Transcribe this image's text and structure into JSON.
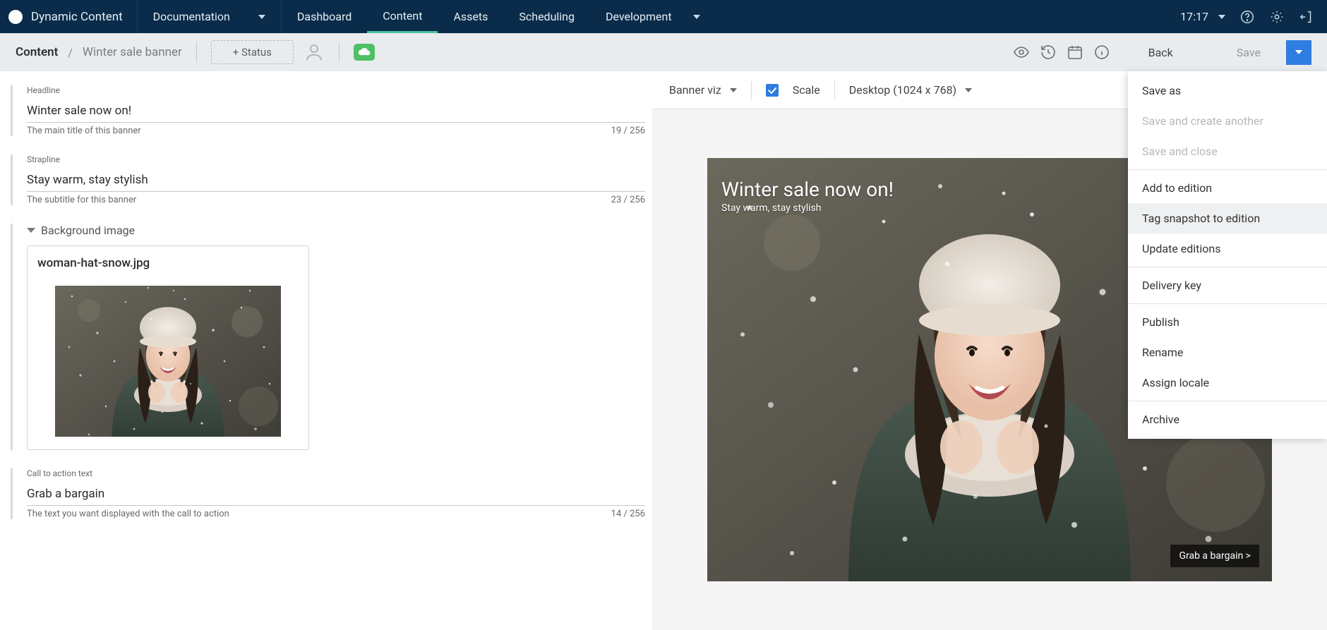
{
  "brand": "Dynamic Content",
  "nav": {
    "documentation": "Documentation",
    "dashboard": "Dashboard",
    "content": "Content",
    "assets": "Assets",
    "scheduling": "Scheduling",
    "development": "Development"
  },
  "clock": "17:17",
  "breadcrumb": {
    "root": "Content",
    "sep": "/",
    "leaf": "Winter sale banner"
  },
  "status_button": "+ Status",
  "buttons": {
    "back": "Back",
    "save": "Save"
  },
  "form": {
    "headline": {
      "label": "Headline",
      "value": "Winter sale now on!",
      "hint": "The main title of this banner",
      "count": "19 / 256"
    },
    "strapline": {
      "label": "Strapline",
      "value": "Stay warm, stay stylish",
      "hint": "The subtitle for this banner",
      "count": "23 / 256"
    },
    "bg_section": "Background image",
    "bg_filename": "woman-hat-snow.jpg",
    "cta": {
      "label": "Call to action text",
      "value": "Grab a bargain",
      "hint": "The text you want displayed with the call to action",
      "count": "14 / 256"
    }
  },
  "preview": {
    "viz_label": "Banner viz",
    "scale_label": "Scale",
    "device_label": "Desktop (1024 x 768)",
    "banner_title": "Winter sale now on!",
    "banner_sub": "Stay warm, stay stylish",
    "banner_cta": "Grab a bargain >"
  },
  "menu": {
    "save_as": "Save as",
    "save_create_another": "Save and create another",
    "save_close": "Save and close",
    "add_edition": "Add to edition",
    "tag_snapshot": "Tag snapshot to edition",
    "update_editions": "Update editions",
    "delivery_key": "Delivery key",
    "publish": "Publish",
    "rename": "Rename",
    "assign_locale": "Assign locale",
    "archive": "Archive"
  }
}
